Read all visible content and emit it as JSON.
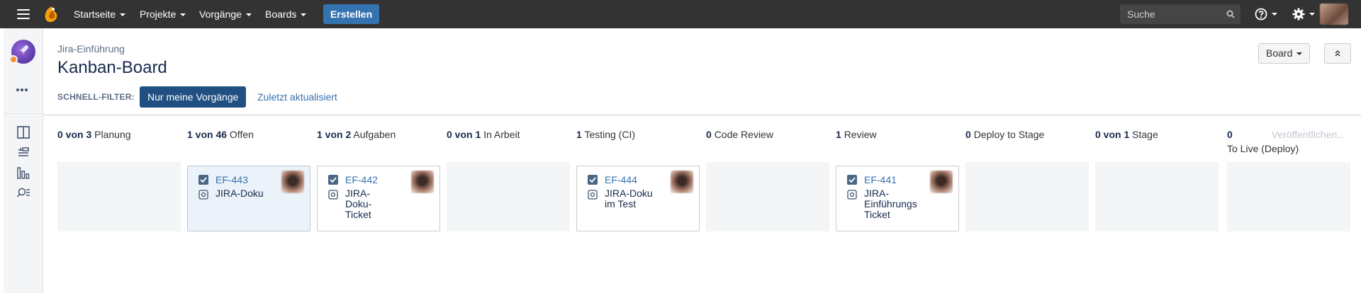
{
  "topnav": {
    "menu": [
      "Startseite",
      "Projekte",
      "Vorgänge",
      "Boards"
    ],
    "create_label": "Erstellen",
    "search_placeholder": "Suche"
  },
  "header": {
    "breadcrumb": "Jira-Einführung",
    "title": "Kanban-Board",
    "board_button": "Board",
    "quick_filter_label": "SCHNELL-FILTER:",
    "quick_filters": [
      "Nur meine Vorgänge",
      "Zuletzt aktualisiert"
    ]
  },
  "columns": [
    {
      "count": "0 von 3",
      "name": "Planung"
    },
    {
      "count": "1 von 46",
      "name": "Offen"
    },
    {
      "count": "1 von 2",
      "name": "Aufgaben"
    },
    {
      "count": "0 von 1",
      "name": "In Arbeit"
    },
    {
      "count": "1",
      "name": "Testing (CI)"
    },
    {
      "count": "0",
      "name": "Code Review"
    },
    {
      "count": "1",
      "name": "Review"
    },
    {
      "count": "0",
      "name": "Deploy to Stage"
    },
    {
      "count": "0 von 1",
      "name": "Stage"
    },
    {
      "count": "0",
      "name": "To Live (Deploy)",
      "sub": "Veröffentlichen..."
    }
  ],
  "cards": [
    {
      "key": "EF-443",
      "summary": "JIRA-Doku"
    },
    {
      "key": "EF-442",
      "summary": "JIRA-Doku-Ticket"
    },
    {
      "key": "EF-444",
      "summary": "JIRA-Doku im Test"
    },
    {
      "key": "EF-441",
      "summary": "JIRA-Einführungs Ticket"
    }
  ],
  "colors": {
    "topbar": "#333333",
    "accent": "#3572b0",
    "filter_active": "#205081",
    "column_bg": "#f4f5f7"
  },
  "icons": [
    "menu-icon",
    "jira-logo-icon",
    "search-icon",
    "help-icon",
    "gear-icon",
    "board-icon",
    "backlog-icon",
    "reports-icon",
    "issues-search-icon",
    "story-checkbox-icon",
    "priority-icon"
  ]
}
